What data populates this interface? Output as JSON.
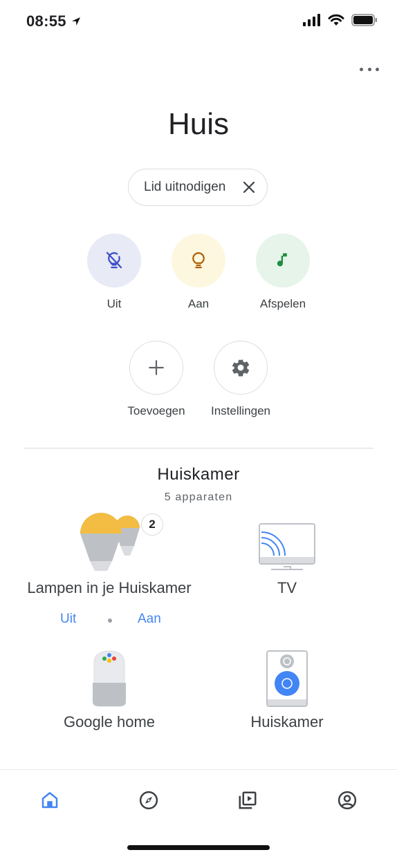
{
  "status": {
    "time": "08:55"
  },
  "header": {
    "title": "Huis",
    "invite_label": "Lid uitnodigen"
  },
  "actions": [
    {
      "label": "Uit",
      "icon": "light-off-icon"
    },
    {
      "label": "Aan",
      "icon": "lightbulb-icon"
    },
    {
      "label": "Afspelen",
      "icon": "music-note-icon"
    }
  ],
  "actions2": [
    {
      "label": "Toevoegen",
      "icon": "plus-icon"
    },
    {
      "label": "Instellingen",
      "icon": "gear-icon"
    }
  ],
  "room": {
    "title": "Huiskamer",
    "subtitle": "5 apparaten",
    "devices": [
      {
        "label": "Lampen in je Huiskamer",
        "badge": "2",
        "off": "Uit",
        "on": "Aan"
      },
      {
        "label": "TV"
      },
      {
        "label": "Google home"
      },
      {
        "label": "Huiskamer"
      }
    ]
  },
  "nav": [
    "home-icon",
    "explore-icon",
    "media-icon",
    "account-icon"
  ],
  "colors": {
    "accent": "#4285f4",
    "off_bg": "#e8eaf6",
    "on_bg": "#fef7e0",
    "play_bg": "#e6f4ea"
  }
}
